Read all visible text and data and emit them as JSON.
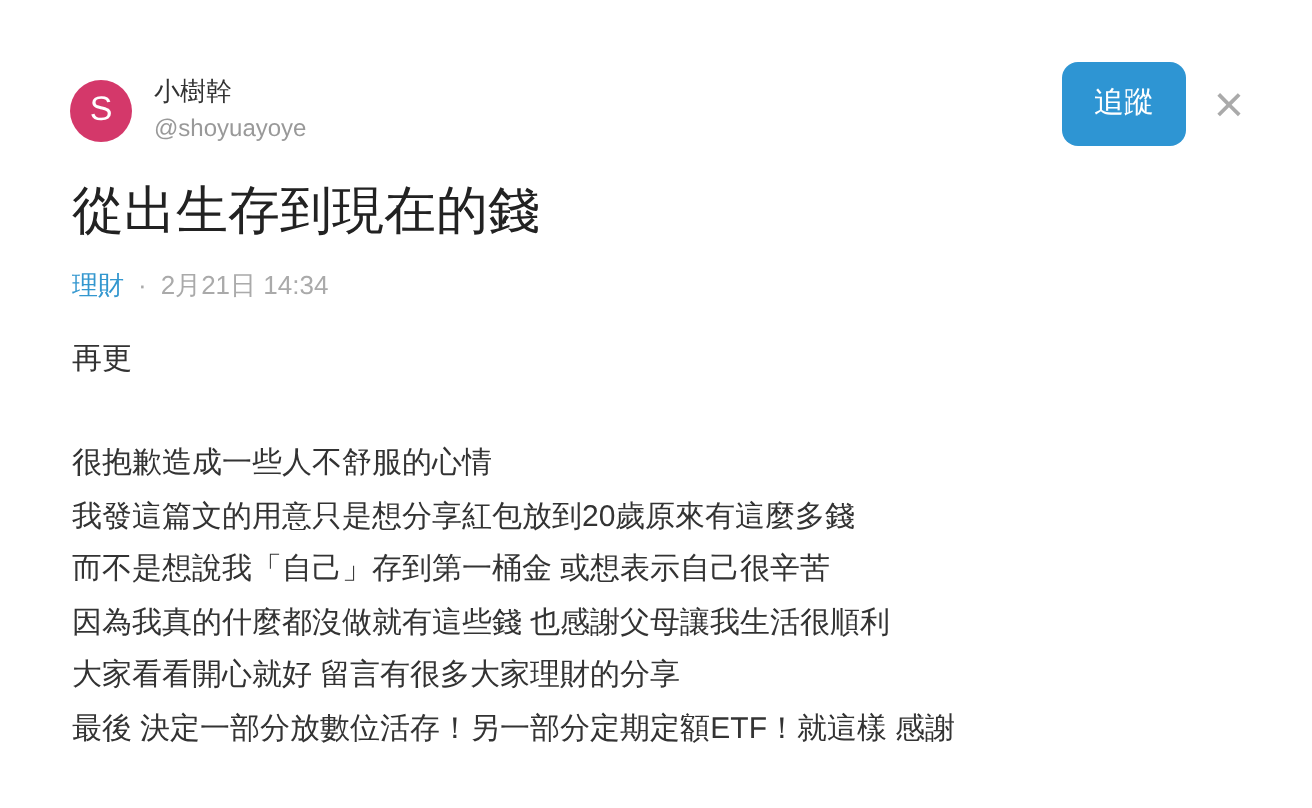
{
  "author": {
    "avatar_letter": "S",
    "name": "小樹幹",
    "handle": "@shoyuayoye"
  },
  "follow_button": "追蹤",
  "close_button": "×",
  "title": "從出生存到現在的錢",
  "meta": {
    "category": "理財",
    "separator": "·",
    "date": "2月21日 14:34"
  },
  "body": [
    [
      "再更"
    ],
    [
      "很抱歉造成一些人不舒服的心情",
      "我發這篇文的用意只是想分享紅包放到20歲原來有這麼多錢",
      "而不是想說我「自己」存到第一桶金 或想表示自己很辛苦",
      "因為我真的什麼都沒做就有這些錢 也感謝父母讓我生活很順利",
      "大家看看開心就好 留言有很多大家理財的分享",
      "最後 決定一部分放數位活存！另一部分定期定額ETF！就這樣 感謝"
    ]
  ]
}
